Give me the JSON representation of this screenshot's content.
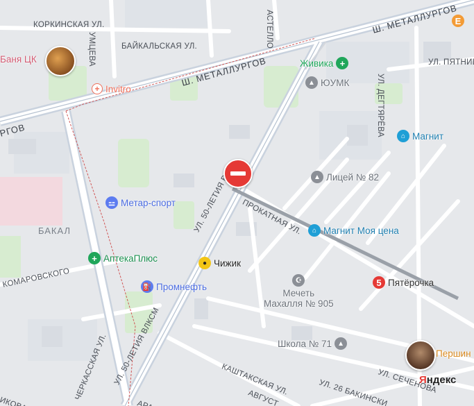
{
  "streets": {
    "korkinskaya": "КОРКИНСКАЯ УЛ.",
    "baikalskaya": "БАЙКАЛЬСКАЯ УЛ.",
    "umtseva": "УМЦЕВА",
    "astello": "АСТЕЛЛО",
    "metallurgov_1": "Ш. МЕТАЛЛУРГОВ",
    "metallurgov_2": "Ш. МЕТАЛЛУРГОВ",
    "metallurgov_left": "РГОВ",
    "degtyareva": "УЛ. ДЕГТЯРЁВА",
    "pyatnitskaya": "УЛ. ПЯТНИЦ",
    "vlksm_upper": "УЛ. 50-ЛЕТИЯ ВЛ...",
    "vlksm_lower": "УЛ. 50-ЛЕТИЯ ВЛКСМ",
    "prokatnaya": "ПРОКАТНАЯ УЛ.",
    "komarovskogo": "КОМАРОВСКОГО",
    "cherkasskaya": "ЧЕРКАССКАЯ УЛ.",
    "kashtakskaya": "КАШТАКСКАЯ УЛ.",
    "avgust": "АВГУСТ",
    "bakinskikh": "УЛ. 26 БАКИНСКИ",
    "sechenova": "УЛ. СЕЧЕНОВА",
    "ara": "АРА",
    "ikova": "ИКОВА"
  },
  "area_label": "БАКАЛ",
  "pois": {
    "banya": "Баня ЦК",
    "invitro": "Invitro",
    "zhivika": "Живика",
    "yumk": "ЮУМК",
    "magnit": "Магнит",
    "liceum": "Лицей № 82",
    "metar": "Метар-спорт",
    "magnit_moya": "Магнит Моя цена",
    "apteka": "АптекаПлюс",
    "chizhik": "Чижик",
    "promneft": "Промнефть",
    "mosque_line1": "Мечеть",
    "mosque_line2": "Махалля № 905",
    "pyaterochka": "Пятёрочка",
    "school": "Школа № 71",
    "pershin": "Першин",
    "cafe_icon_letter": "E"
  },
  "logo": {
    "first_letter": "Я",
    "rest": "ндекс"
  },
  "colors": {
    "pharmacy_green": "#1fa65a",
    "shop_blue": "#1f9fd6",
    "sport_blue": "#5d7cf0",
    "edu_gray": "#8b8f96",
    "pyaterochka_red": "#e53935",
    "invitro_red": "#ef6f5a",
    "cafe_orange": "#f39b36"
  }
}
